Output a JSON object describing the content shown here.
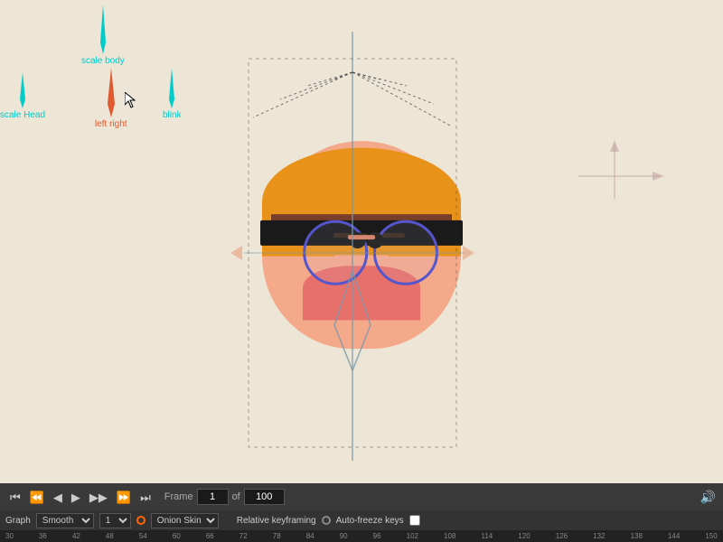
{
  "controls": {
    "scale_body": "scale body",
    "scale_head": "scale Head",
    "left_right": "left right",
    "blink": "blink"
  },
  "transport": {
    "frame_label": "Frame",
    "frame_value": "1",
    "of_label": "of",
    "total_frames": "100"
  },
  "timeline_controls": {
    "graph_label": "Graph",
    "smooth_label": "Smooth",
    "smooth_value": "Smooth",
    "number_value": "1",
    "onion_skins_label": "Onion Skins",
    "relative_keyframing_label": "Relative keyframing",
    "auto_freeze_label": "Auto-freeze keys"
  },
  "ruler_ticks": [
    "30",
    "36",
    "42",
    "48",
    "54",
    "60",
    "66",
    "72",
    "78",
    "84",
    "90",
    "96",
    "102",
    "108",
    "114",
    "120",
    "126",
    "132",
    "138",
    "144",
    "150"
  ],
  "colors": {
    "background": "#ede5d5",
    "skin": "#f4a98a",
    "hair": "#e8921a",
    "hairband": "#1a1a1a",
    "glasses": "#5555cc",
    "rig_lines": "#6699aa",
    "rig_dotted": "#333333",
    "ctrl_cyan": "#00cccc",
    "ctrl_orange": "#e05a30",
    "timeline_bg": "#2a2a2a"
  }
}
